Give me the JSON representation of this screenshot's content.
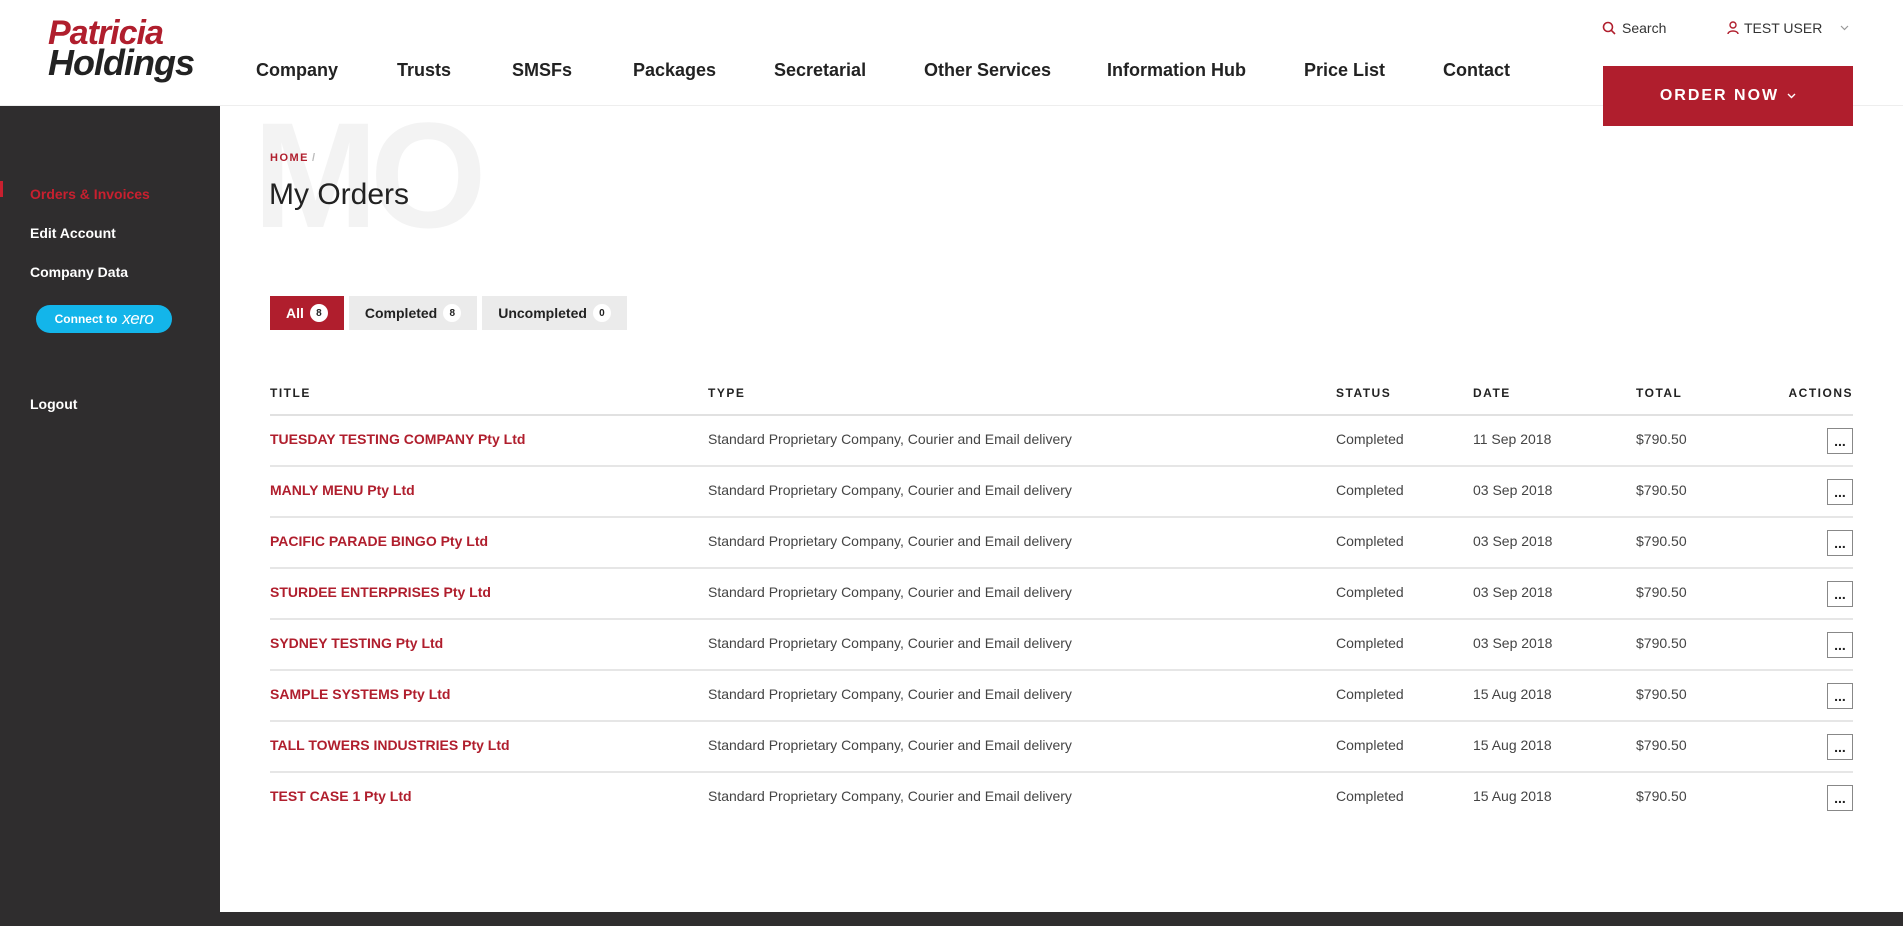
{
  "brand": {
    "line1": "Patricia",
    "line2": "Holdings"
  },
  "nav": [
    {
      "label": "Company"
    },
    {
      "label": "Trusts"
    },
    {
      "label": "SMSFs"
    },
    {
      "label": "Packages"
    },
    {
      "label": "Secretarial"
    },
    {
      "label": "Other Services"
    },
    {
      "label": "Information Hub"
    },
    {
      "label": "Price List"
    },
    {
      "label": "Contact"
    }
  ],
  "top": {
    "search_label": "Search",
    "user_label": "TEST USER",
    "order_button": "ORDER NOW"
  },
  "sidebar": {
    "items": [
      {
        "label": "Orders & Invoices",
        "active": true
      },
      {
        "label": "Edit Account"
      },
      {
        "label": "Company Data"
      }
    ],
    "xero": {
      "prefix": "Connect to",
      "word": "xero"
    },
    "logout": "Logout"
  },
  "page": {
    "watermark": "MO",
    "breadcrumb": "HOME",
    "breadcrumb_sep": "/",
    "title": "My Orders"
  },
  "tabs": [
    {
      "label": "All",
      "count": "8",
      "active": true
    },
    {
      "label": "Completed",
      "count": "8"
    },
    {
      "label": "Uncompleted",
      "count": "0"
    }
  ],
  "table": {
    "headers": {
      "title": "TITLE",
      "type": "TYPE",
      "status": "STATUS",
      "date": "DATE",
      "total": "TOTAL",
      "actions": "ACTIONS"
    },
    "rows": [
      {
        "title": "TUESDAY TESTING COMPANY Pty Ltd",
        "type": "Standard Proprietary Company, Courier and Email delivery",
        "status": "Completed",
        "date": "11 Sep 2018",
        "total": "$790.50",
        "actions": "..."
      },
      {
        "title": "MANLY MENU Pty Ltd",
        "type": "Standard Proprietary Company, Courier and Email delivery",
        "status": "Completed",
        "date": "03 Sep 2018",
        "total": "$790.50",
        "actions": "..."
      },
      {
        "title": "PACIFIC PARADE BINGO Pty Ltd",
        "type": "Standard Proprietary Company, Courier and Email delivery",
        "status": "Completed",
        "date": "03 Sep 2018",
        "total": "$790.50",
        "actions": "..."
      },
      {
        "title": "STURDEE ENTERPRISES Pty Ltd",
        "type": "Standard Proprietary Company, Courier and Email delivery",
        "status": "Completed",
        "date": "03 Sep 2018",
        "total": "$790.50",
        "actions": "..."
      },
      {
        "title": "SYDNEY TESTING Pty Ltd",
        "type": "Standard Proprietary Company, Courier and Email delivery",
        "status": "Completed",
        "date": "03 Sep 2018",
        "total": "$790.50",
        "actions": "..."
      },
      {
        "title": "SAMPLE SYSTEMS Pty Ltd",
        "type": "Standard Proprietary Company, Courier and Email delivery",
        "status": "Completed",
        "date": "15 Aug 2018",
        "total": "$790.50",
        "actions": "..."
      },
      {
        "title": "TALL TOWERS INDUSTRIES Pty Ltd",
        "type": "Standard Proprietary Company, Courier and Email delivery",
        "status": "Completed",
        "date": "15 Aug 2018",
        "total": "$790.50",
        "actions": "..."
      },
      {
        "title": "TEST CASE 1 Pty Ltd",
        "type": "Standard Proprietary Company, Courier and Email delivery",
        "status": "Completed",
        "date": "15 Aug 2018",
        "total": "$790.50",
        "actions": "..."
      }
    ]
  },
  "colors": {
    "brand_red": "#b01e2d",
    "sidebar_bg": "#2f2d2e",
    "xero_blue": "#13b5ea"
  },
  "icons": {
    "search": "search-icon",
    "user": "user-icon",
    "chevron": "chevron-down-icon"
  }
}
